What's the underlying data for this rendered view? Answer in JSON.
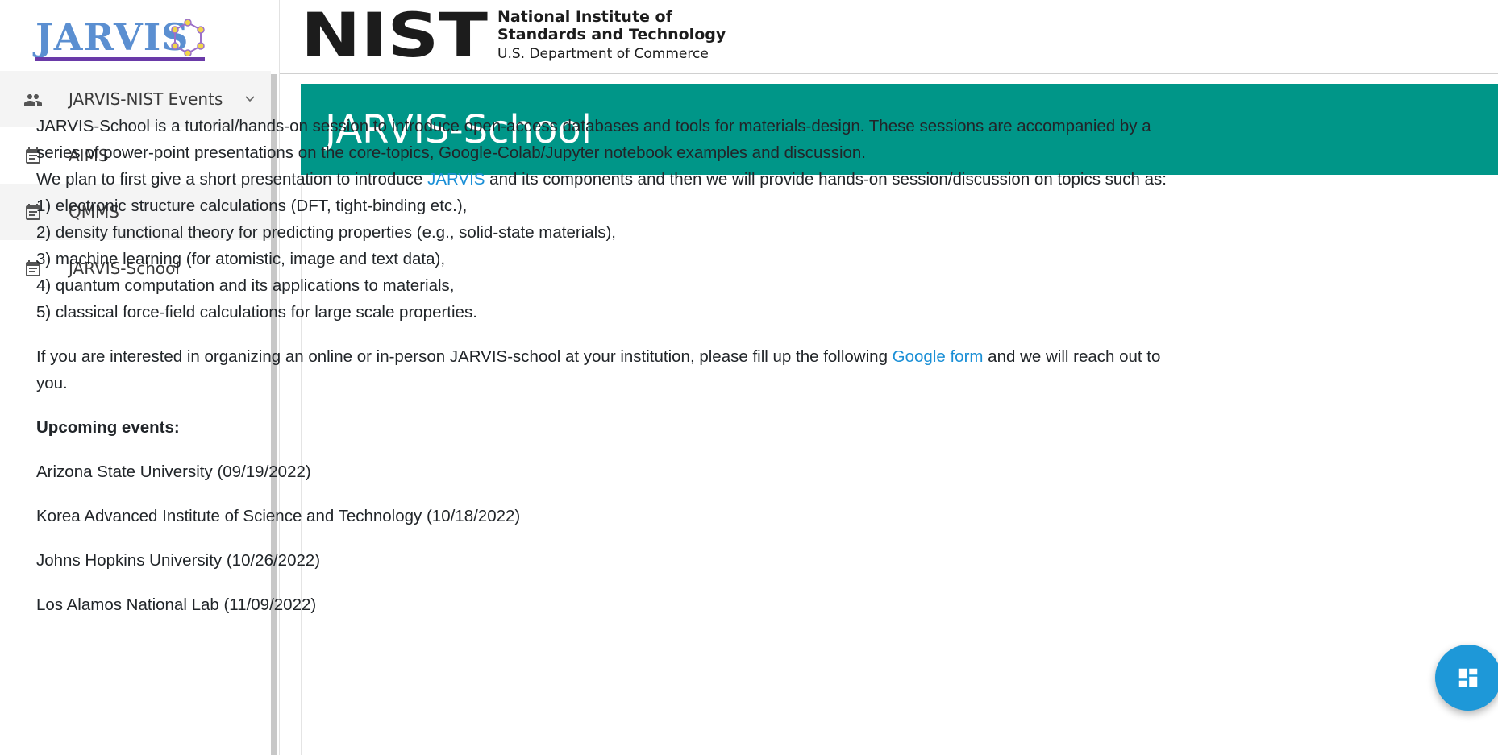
{
  "logo": {
    "text": "JARVIS"
  },
  "sidebar": {
    "items": [
      {
        "label": "JARVIS-NIST Events",
        "icon": "people-icon",
        "expandable": true
      },
      {
        "label": "AIMS",
        "icon": "event-note-icon"
      },
      {
        "label": "QMMS",
        "icon": "event-note-icon"
      },
      {
        "label": "JARVIS-School",
        "icon": "event-note-icon"
      }
    ]
  },
  "header": {
    "logo_mark": "NIST",
    "line1": "National Institute of",
    "line2": "Standards and Technology",
    "line3": "U.S. Department of Commerce"
  },
  "page": {
    "title": "JARVIS-School",
    "intro1": "JARVIS-School is a tutorial/hands-on session to introduce open-access databases and tools for materials-design. These sessions are accompanied by a series of power-point presentations on the core-topics, Google-Colab/Jupyter notebook examples and discussion.",
    "intro2_pre": "We plan to first give a short presentation to introduce ",
    "intro2_link": "JARVIS",
    "intro2_post": " and its components and then we will provide hands-on session/discussion on topics such as:",
    "topics": [
      "1) electronic structure calculations (DFT, tight-binding etc.),",
      "2) density functional theory for predicting properties (e.g., solid-state materials),",
      "3) machine learning (for atomistic, image and text data),",
      "4) quantum computation and its applications to materials,",
      "5) classical force-field calculations for large scale properties."
    ],
    "interest_pre": "If you are interested in organizing an online or in-person JARVIS-school at your institution, please fill up the following ",
    "interest_link": "Google form",
    "interest_post": " and we will reach out to you.",
    "upcoming_heading": "Upcoming events:",
    "events": [
      "Arizona State University (09/19/2022)",
      "Korea Advanced Institute of Science and Technology (10/18/2022)",
      "Johns Hopkins University (10/26/2022)",
      "Los Alamos National Lab (11/09/2022)"
    ]
  },
  "colors": {
    "banner": "#009688",
    "link": "#1a8fd6",
    "fab": "#1e98d8",
    "logo_blue": "#5b8fd1",
    "logo_purple": "#6a3aa8"
  }
}
